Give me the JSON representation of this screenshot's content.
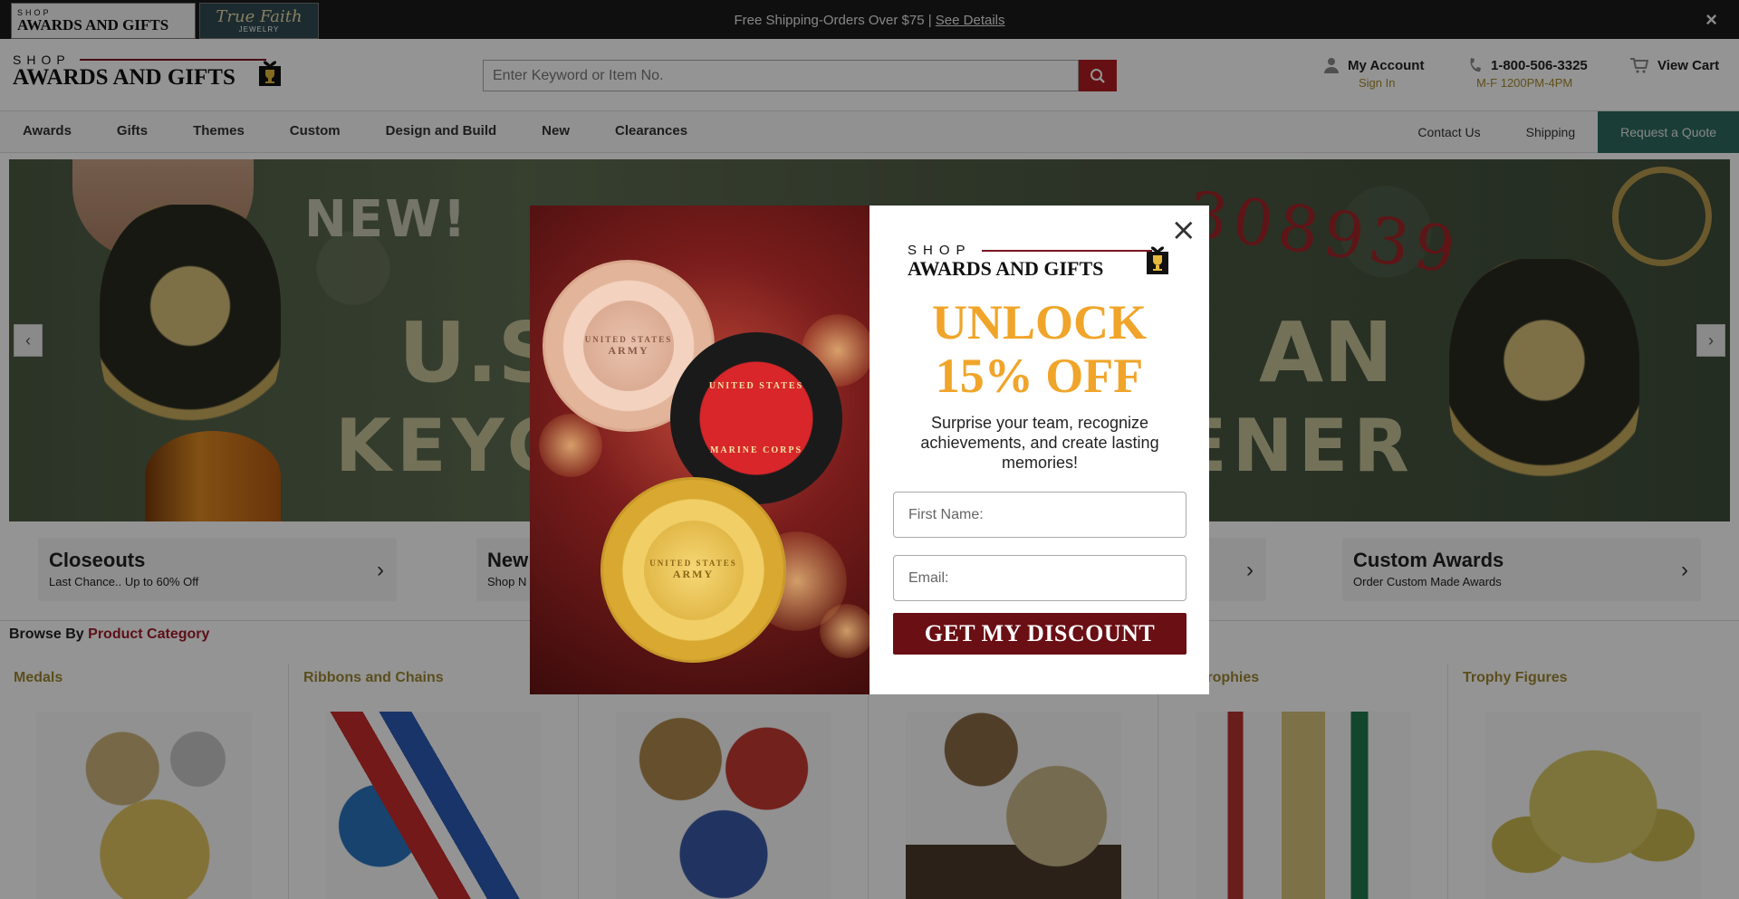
{
  "topbar": {
    "brand_active_small": "SHOP",
    "brand_active_big": "AWARDS AND GIFTS",
    "brand_other_script": "True Faith",
    "brand_other_sub": "JEWELRY",
    "promo_text": "Free Shipping-Orders Over $75 | ",
    "promo_link": "See Details",
    "close_icon": "×"
  },
  "header": {
    "logo_small": "SHOP",
    "logo_big": "AWARDS AND GIFTS",
    "search_placeholder": "Enter Keyword or Item No.",
    "account_label": "My Account",
    "account_sub": "Sign In",
    "phone": "1-800-506-3325",
    "phone_hours": "M-F 1200PM-4PM",
    "cart_label": "View Cart",
    "icons": {
      "search": "search-icon",
      "account": "user-icon",
      "phone": "phone-icon",
      "cart": "cart-icon"
    }
  },
  "nav": {
    "left": [
      "Awards",
      "Gifts",
      "Themes",
      "Custom",
      "Design and Build",
      "New",
      "Clearances"
    ],
    "right": [
      "Contact Us",
      "Shipping",
      "Request a Quote"
    ]
  },
  "hero": {
    "line_new": "NEW!",
    "left_line1": "U.S",
    "left_line2": "KEYC",
    "right_line1": "AN",
    "right_line2": "ENER",
    "item_number": "308939",
    "prev": "‹",
    "next": "›"
  },
  "tiles": [
    {
      "title": "Closeouts",
      "sub": "Last Chance.. Up to 60% Off"
    },
    {
      "title": "New",
      "sub": "Shop N"
    },
    {
      "title": "",
      "sub": ""
    },
    {
      "title": "Custom Awards",
      "sub": "Order Custom Made Awards"
    }
  ],
  "browse": {
    "prefix": "Browse By ",
    "highlight": "Product Category"
  },
  "categories": [
    "Medals",
    "Ribbons and Chains",
    "",
    "",
    "mn Trophies",
    "Trophy Figures"
  ],
  "modal": {
    "logo_small": "SHOP",
    "logo_big": "AWARDS AND GIFTS",
    "unlock_line1": "UNLOCK",
    "unlock_line2": "15% OFF",
    "pitch": "Surprise your team, recognize achievements, and create lasting memories!",
    "first_name_placeholder": "First Name:",
    "email_placeholder": "Email:",
    "cta": "GET MY DISCOUNT",
    "close": "×",
    "coins": [
      {
        "top": "UNITED STATES",
        "bottom": "ARMY"
      },
      {
        "top": "UNITED STATES",
        "bottom": "MARINE CORPS"
      },
      {
        "top": "UNITED STATES",
        "bottom": "ARMY"
      }
    ]
  },
  "colors": {
    "accent_red": "#b21d22",
    "cta_maroon": "#6a0f14",
    "gold": "#f0a52a",
    "quote_green": "#2d6b5f",
    "category_gold": "#9d8733"
  }
}
